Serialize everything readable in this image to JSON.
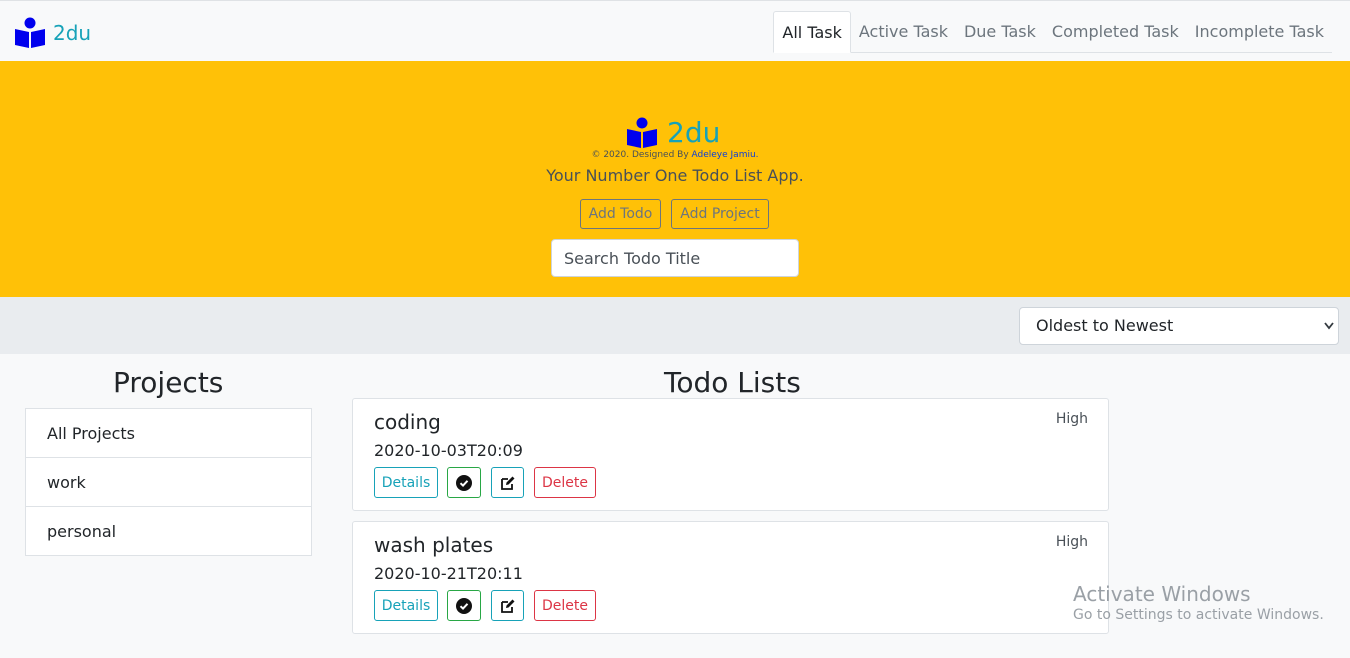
{
  "nav": {
    "brand": "2du",
    "tabs": [
      "All Task",
      "Active Task",
      "Due Task",
      "Completed Task",
      "Incomplete Task"
    ]
  },
  "hero": {
    "brand": "2du",
    "copyright_prefix": "© 2020. Designed By ",
    "author": "Adeleye Jamiu.",
    "tagline": "Your Number One Todo List App.",
    "add_todo": "Add Todo",
    "add_project": "Add Project",
    "search_placeholder": "Search Todo Title"
  },
  "sort": {
    "selected": "Oldest to Newest"
  },
  "projects": {
    "title": "Projects",
    "items": [
      "All Projects",
      "work",
      "personal"
    ]
  },
  "todos": {
    "title": "Todo Lists",
    "items": [
      {
        "title": "coding",
        "date": "2020-10-03T20:09",
        "priority": "High"
      },
      {
        "title": "wash plates",
        "date": "2020-10-21T20:11",
        "priority": "High"
      }
    ],
    "details_label": "Details",
    "delete_label": "Delete"
  },
  "watermark": {
    "title": "Activate Windows",
    "subtitle": "Go to Settings to activate Windows."
  },
  "colors": {
    "accent": "#17a2b8",
    "hero_bg": "#ffc107",
    "logo_blue": "#0000ee",
    "danger": "#dc3545",
    "success": "#28a745"
  }
}
